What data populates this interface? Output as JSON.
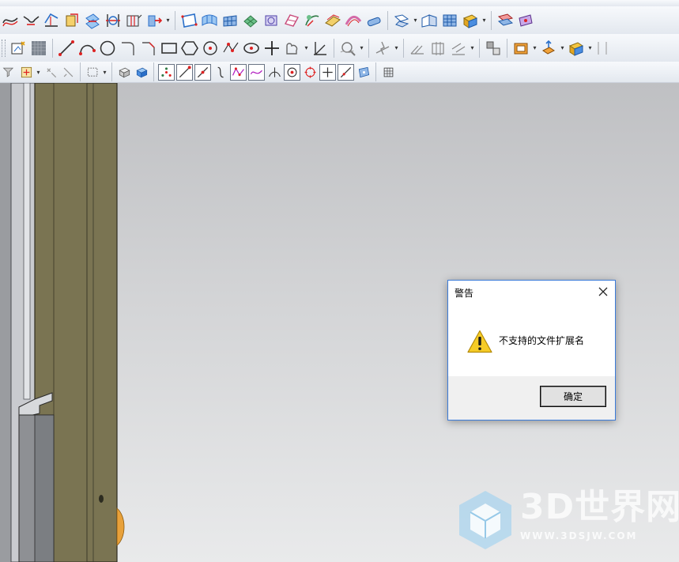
{
  "dialog": {
    "title": "警告",
    "message": "不支持的文件扩展名",
    "ok_label": "确定",
    "icon": "warning-icon",
    "accent": "#3b7bd9"
  },
  "viewport": {
    "model_color": "#7a7452"
  },
  "watermark": {
    "brand": "3D世界网",
    "url": "WWW.3DSJW.COM"
  },
  "toolbars": {
    "row1_icons": [
      "curve-offset-icon",
      "curve-bridge-icon",
      "curve-project-icon",
      "extract-geometry-icon",
      "section-curve-icon",
      "intersection-curve-icon",
      "isoparametric-curve-icon",
      "combined-curve-icon",
      "bounded-plane-icon",
      "through-curves-icon",
      "through-curve-mesh-icon",
      "n-sided-surface-icon",
      "swept-icon",
      "studio-surface-icon",
      "styled-sweep-icon",
      "offset-surface-icon",
      "extension-surface-icon",
      "law-extension-icon",
      "trim-sheet-icon",
      "sewn-icon",
      "patch-icon"
    ],
    "row2_icons": [
      "sketch-icon",
      "sketch-face-icon",
      "line-icon",
      "arc-icon",
      "circle-icon",
      "fillet-icon",
      "chamfer-icon",
      "rectangle-icon",
      "polygon-icon",
      "point-icon",
      "studio-spline-icon",
      "ellipse-icon",
      "crosshair-point-icon",
      "profile-icon",
      "angle-icon",
      "analysis-icon",
      "deviation-icon",
      "draft-analysis-icon",
      "section-analysis-icon",
      "layer-settings-icon",
      "extract-body-icon",
      "offset-face-icon",
      "move-face-icon"
    ],
    "row3_icons": [
      "select-filter-icon",
      "snap-point-icon",
      "selection-box-icon",
      "solid-view-icon",
      "shaded-view-icon",
      "control-point-icon",
      "end-point-icon",
      "mid-point-icon",
      "curve-point-icon",
      "spline-pole-icon",
      "spline-defining-icon",
      "intersection-point-icon",
      "arc-center-icon",
      "quadrant-point-icon",
      "existing-point-icon",
      "point-on-curve-icon",
      "point-on-face-icon",
      "grid-icon"
    ]
  }
}
